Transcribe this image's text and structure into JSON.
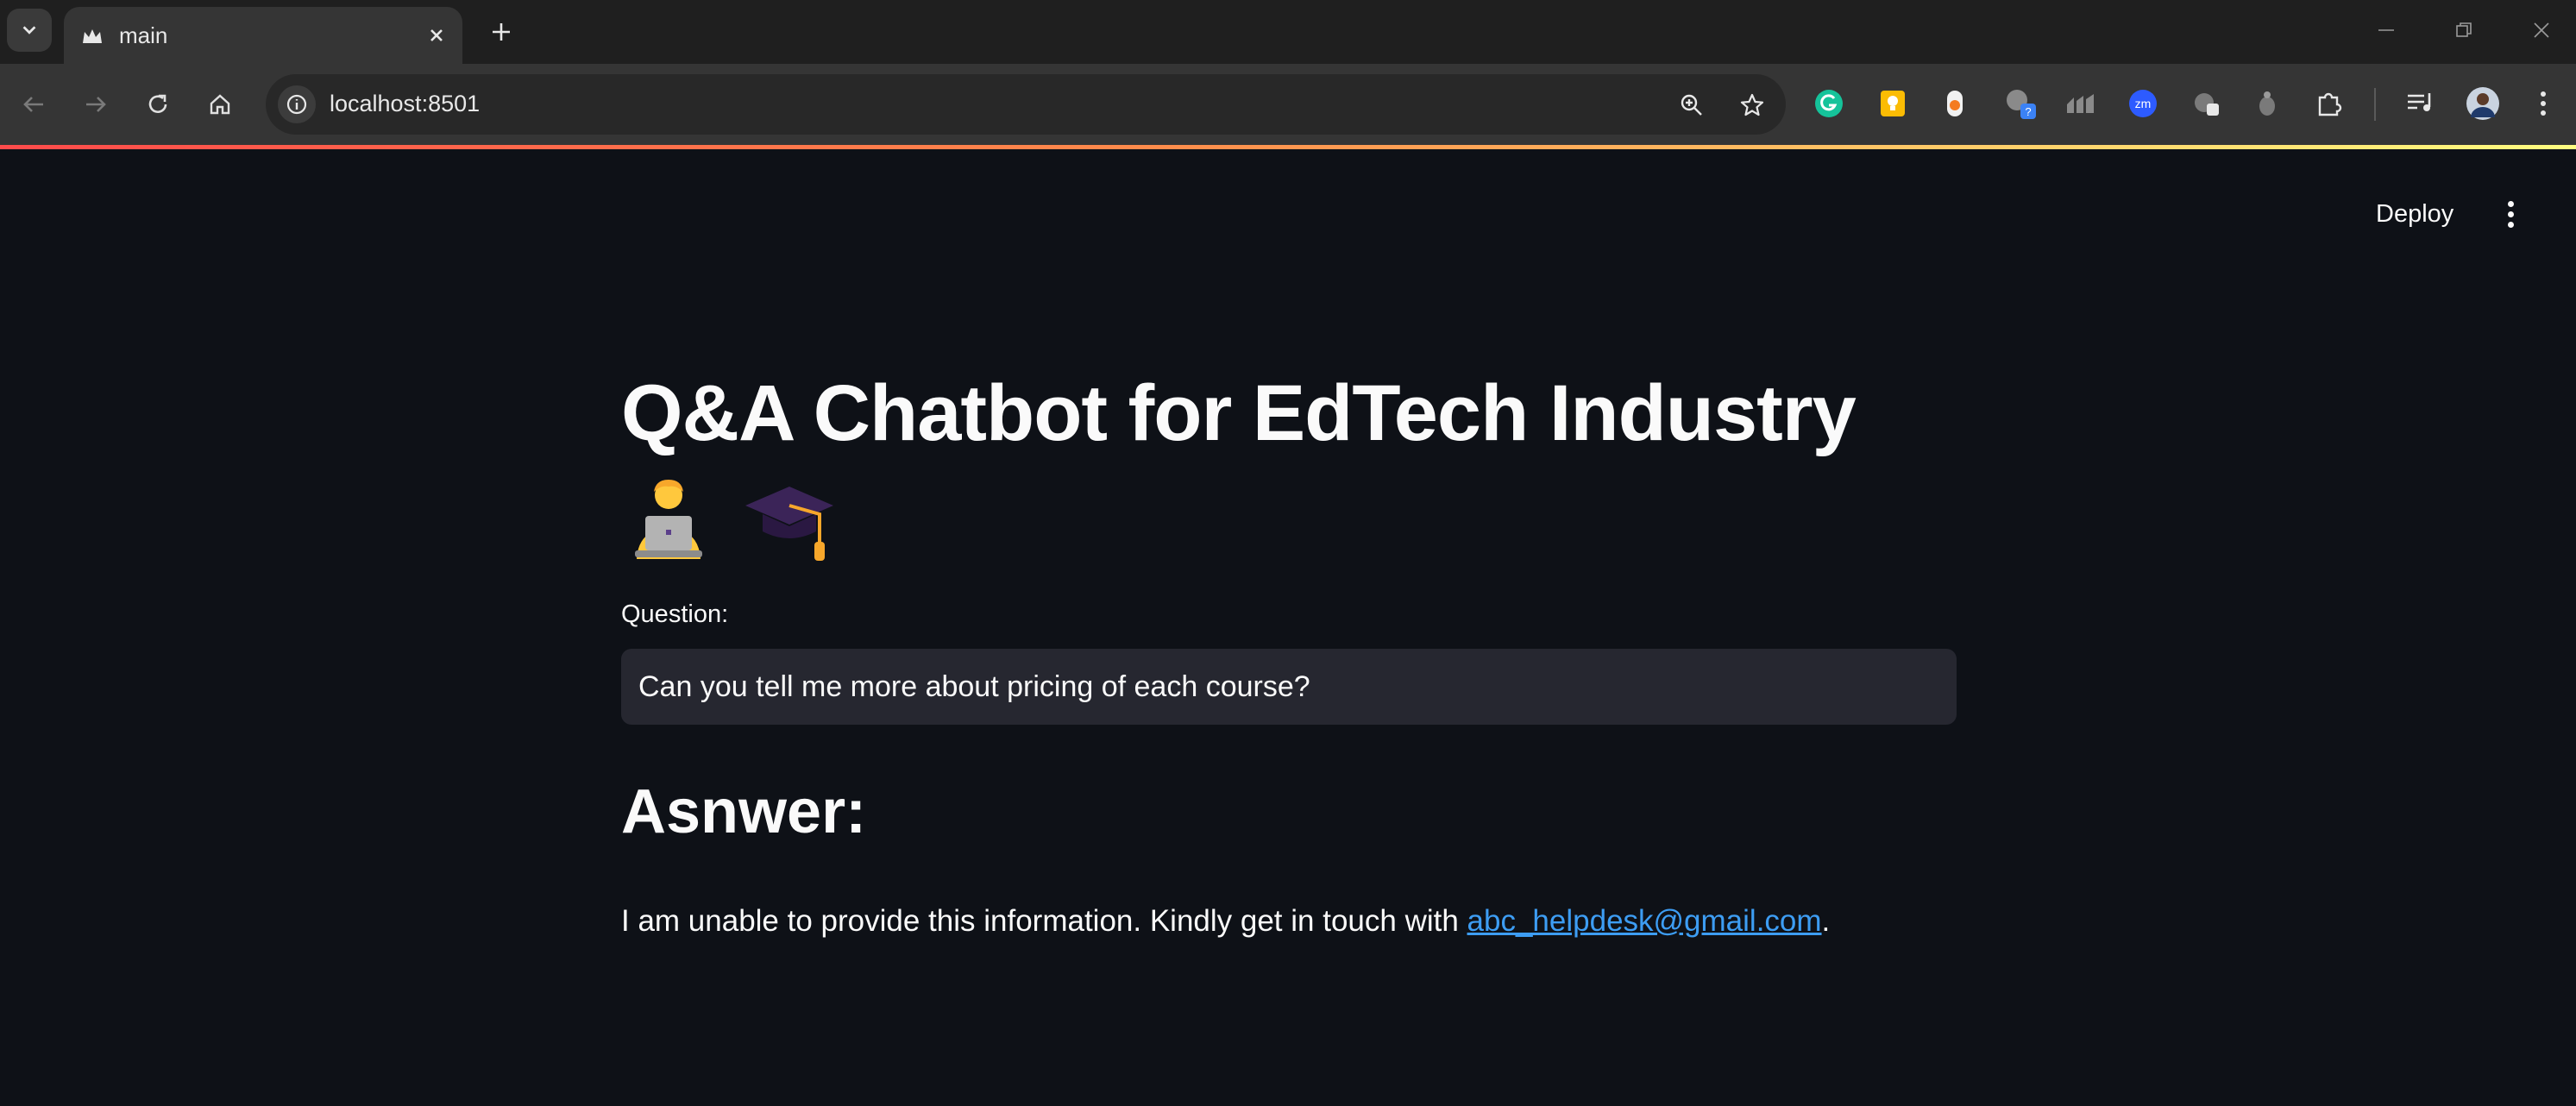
{
  "browser": {
    "tab_title": "main",
    "url": "localhost:8501",
    "colors": {
      "tab_bg": "#353535",
      "toolbar_bg": "#353535",
      "strip_bg": "#1f1f1f"
    }
  },
  "extensions": [
    {
      "name": "grammarly-icon"
    },
    {
      "name": "keep-icon"
    },
    {
      "name": "extension-icon"
    },
    {
      "name": "extension-badge-icon"
    },
    {
      "name": "analytics-icon"
    },
    {
      "name": "zoom-icon"
    },
    {
      "name": "extension-icon"
    },
    {
      "name": "extension-icon"
    },
    {
      "name": "extensions-puzzle-icon"
    }
  ],
  "app": {
    "deploy_label": "Deploy",
    "title": "Q&A Chatbot for EdTech Industry",
    "title_emojis": [
      "🧑‍💻",
      "🎓"
    ],
    "question_label": "Question:",
    "question_value": "Can you tell me more about pricing of each course?",
    "answer_heading": "Asnwer:",
    "answer_prefix": "I am unable to provide this information. Kindly get in touch with ",
    "answer_link": "abc_helpdesk@gmail.com",
    "answer_suffix": ".",
    "colors": {
      "background": "#0e1117",
      "input_bg": "#262730",
      "link": "#3d9df3",
      "accent": "#ff4b4b"
    }
  }
}
